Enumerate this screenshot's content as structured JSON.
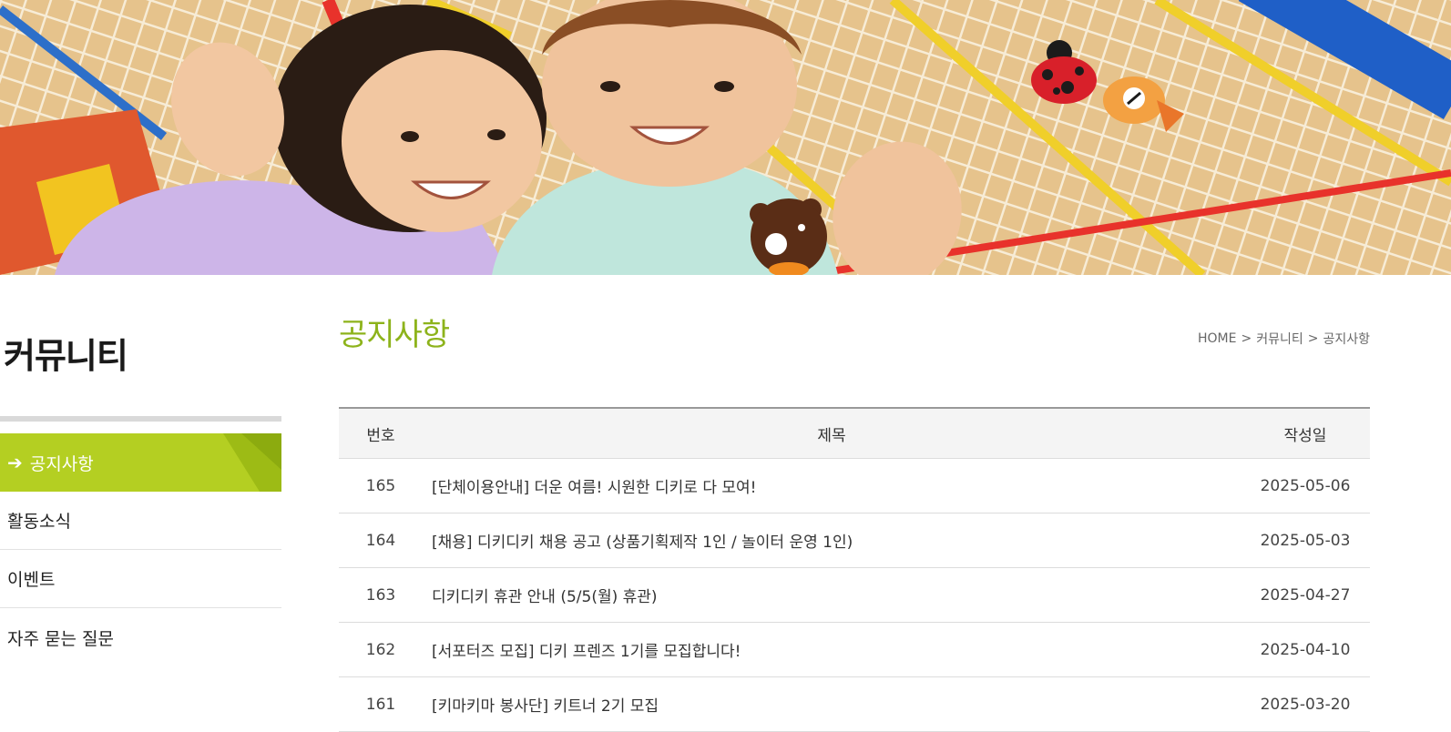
{
  "hero": {
    "image": "kids-waving-on-rope-net-banner",
    "characters": [
      "ladybug-mascot",
      "bear-mascot",
      "orange-fish-mascot"
    ]
  },
  "sidebar": {
    "title": "커뮤니티",
    "items": [
      {
        "label": "공지사항",
        "active": true,
        "icon": "arrow-right-icon"
      },
      {
        "label": "활동소식",
        "active": false
      },
      {
        "label": "이벤트",
        "active": false
      },
      {
        "label": "자주 묻는 질문",
        "active": false
      }
    ]
  },
  "main": {
    "title": "공지사항",
    "breadcrumb": [
      "HOME",
      "커뮤니티",
      "공지사항"
    ],
    "breadcrumb_separator": ">",
    "table": {
      "headers": [
        "번호",
        "제목",
        "작성일"
      ],
      "rows": [
        {
          "num": "165",
          "title": "[단체이용안내] 더운 여름! 시원한 디키로 다 모여!",
          "date": "2025-05-06"
        },
        {
          "num": "164",
          "title": "[채용] 디키디키 채용 공고 (상품기획제작 1인 / 놀이터 운영 1인)",
          "date": "2025-05-03"
        },
        {
          "num": "163",
          "title": "디키디키 휴관 안내 (5/5(월) 휴관)",
          "date": "2025-04-27"
        },
        {
          "num": "162",
          "title": "[서포터즈 모집] 디키 프렌즈 1기를 모집합니다!",
          "date": "2025-04-10"
        },
        {
          "num": "161",
          "title": "[키마키마 봉사단] 키트너 2기 모집",
          "date": "2025-03-20"
        }
      ]
    }
  },
  "colors": {
    "accent_green": "#b4cf22",
    "title_green": "#8db31b"
  }
}
